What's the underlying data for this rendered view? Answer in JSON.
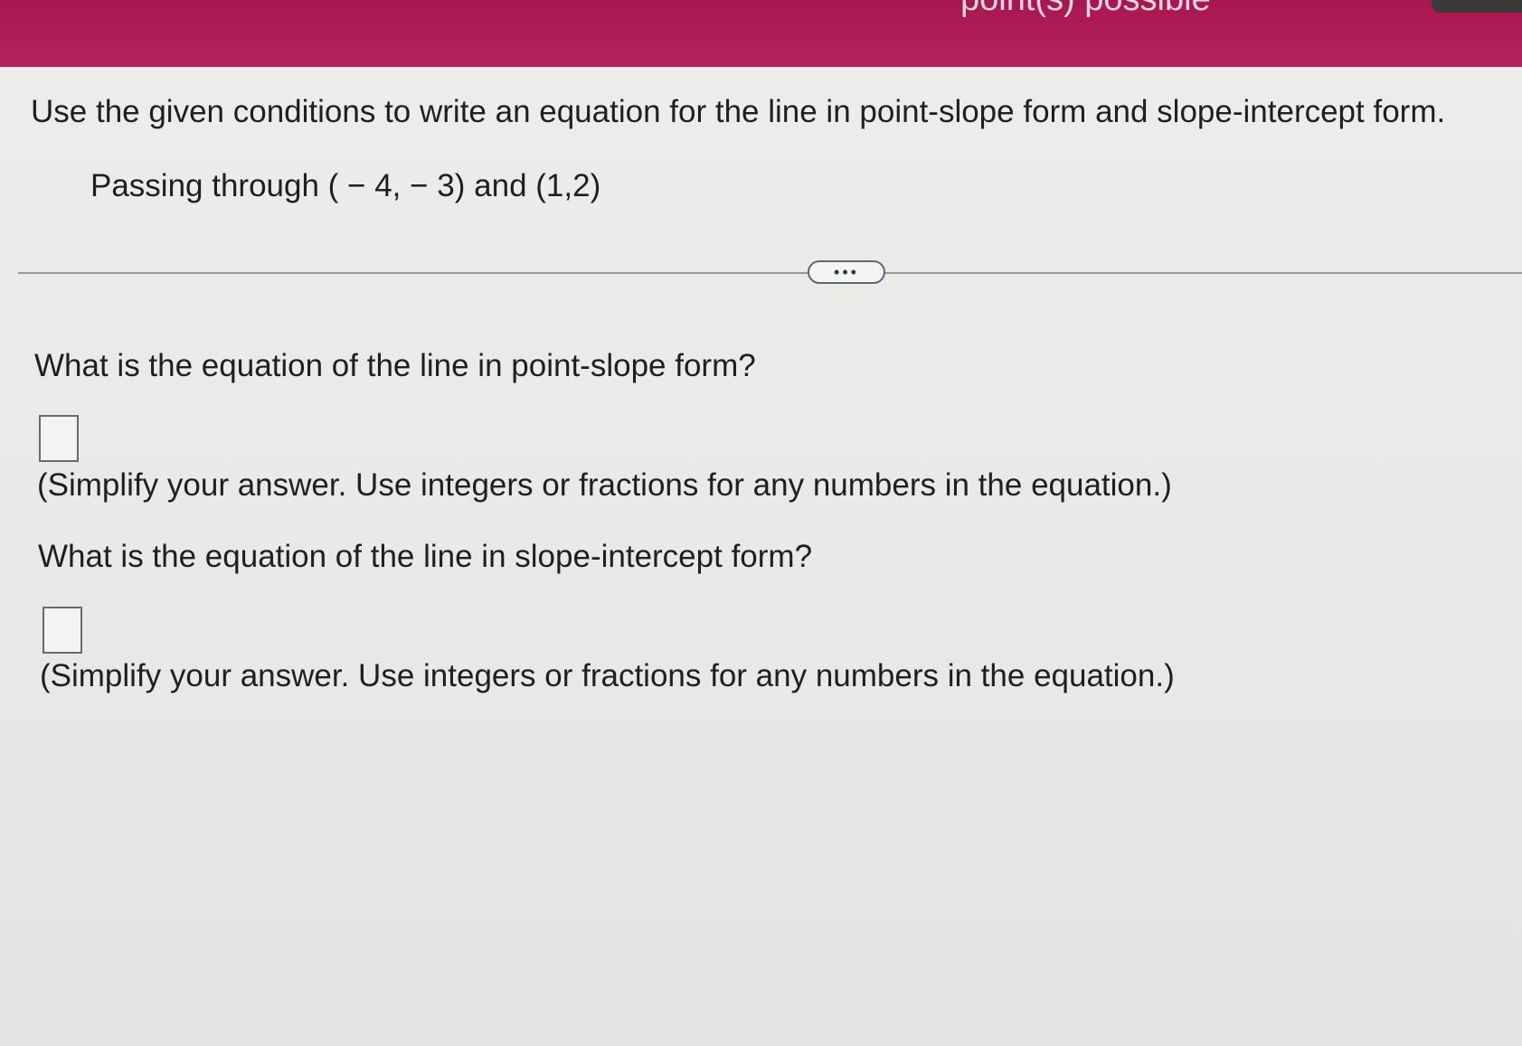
{
  "header": {
    "points_label": "point(s) possible"
  },
  "problem": {
    "instruction": "Use the given conditions to write an equation for the line in point-slope form and slope-intercept form.",
    "condition": "Passing through ( − 4, − 3) and (1,2)"
  },
  "more_button": {
    "label": "•••"
  },
  "questions": [
    {
      "prompt": "What is the equation of the line in point-slope form?",
      "answer_value": "",
      "hint": "(Simplify your answer. Use integers or fractions for any numbers in the equation.)"
    },
    {
      "prompt": "What is the equation of the line in slope-intercept form?",
      "answer_value": "",
      "hint": "(Simplify your answer. Use integers or fractions for any numbers in the equation.)"
    }
  ],
  "colors": {
    "header_bar": "#a8174f",
    "background": "#e9e9e7",
    "divider": "#8f99a6"
  }
}
